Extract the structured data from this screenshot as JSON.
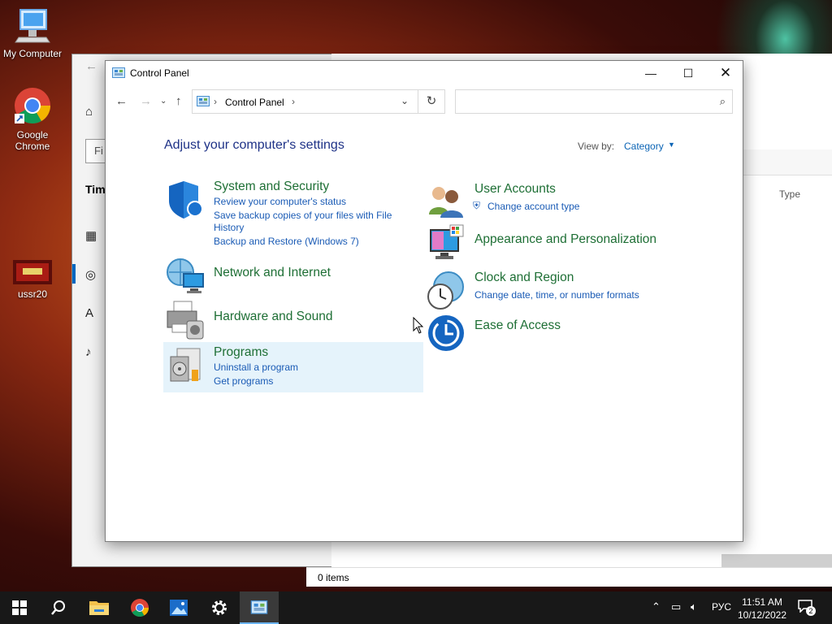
{
  "desktop": {
    "icons": [
      {
        "label": "My Computer"
      },
      {
        "label": "Google Chrome"
      },
      {
        "label": "ussr20"
      }
    ]
  },
  "background_window": {
    "find_placeholder": "Fi",
    "section_label": "Tim",
    "column_type": "Type",
    "status_items": "0 items"
  },
  "control_panel": {
    "title": "Control Panel",
    "address": {
      "crumb": "Control Panel"
    },
    "search": {
      "placeholder": ""
    },
    "heading": "Adjust your computer's settings",
    "view_by": {
      "label": "View by:",
      "value": "Category"
    },
    "categories": [
      {
        "title": "System and Security",
        "links": [
          "Review your computer's status",
          "Save backup copies of your files with File",
          "History",
          "Backup and Restore (Windows 7)"
        ]
      },
      {
        "title": "Network and Internet",
        "links": []
      },
      {
        "title": "Hardware and Sound",
        "links": []
      },
      {
        "title": "Programs",
        "links": [
          "Uninstall a program",
          "Get programs"
        ]
      },
      {
        "title": "User Accounts",
        "links": [
          "Change account type"
        ]
      },
      {
        "title": "Appearance and Personalization",
        "links": []
      },
      {
        "title": "Clock and Region",
        "links": [
          "Change date, time, or number formats"
        ]
      },
      {
        "title": "Ease of Access",
        "links": []
      }
    ]
  },
  "taskbar": {
    "apps": [
      "start-icon",
      "search-icon",
      "file-explorer-icon",
      "chrome-icon",
      "photos-icon",
      "settings-icon",
      "control-panel-icon"
    ],
    "language": "РУС",
    "time": "11:51 AM",
    "date": "10/12/2022",
    "notification_count": "2"
  },
  "colors": {
    "link": "#1a5bb5",
    "category_title": "#1e6f35",
    "heading": "#1e3287",
    "accent": "#0067c0"
  }
}
